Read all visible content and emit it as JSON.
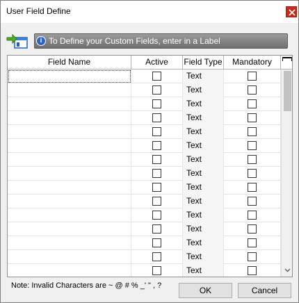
{
  "window": {
    "title": "User Field Define"
  },
  "toolbar": {
    "icon": "define-fields-icon"
  },
  "banner": {
    "text": "To Define your Custom Fields, enter in a  Label"
  },
  "grid": {
    "columns": [
      "Field Name",
      "Active",
      "Field Type",
      "Mandatory"
    ],
    "rows": [
      {
        "field_name": "",
        "active": false,
        "field_type": "Text",
        "mandatory": false
      },
      {
        "field_name": "",
        "active": false,
        "field_type": "Text",
        "mandatory": false
      },
      {
        "field_name": "",
        "active": false,
        "field_type": "Text",
        "mandatory": false
      },
      {
        "field_name": "",
        "active": false,
        "field_type": "Text",
        "mandatory": false
      },
      {
        "field_name": "",
        "active": false,
        "field_type": "Text",
        "mandatory": false
      },
      {
        "field_name": "",
        "active": false,
        "field_type": "Text",
        "mandatory": false
      },
      {
        "field_name": "",
        "active": false,
        "field_type": "Text",
        "mandatory": false
      },
      {
        "field_name": "",
        "active": false,
        "field_type": "Text",
        "mandatory": false
      },
      {
        "field_name": "",
        "active": false,
        "field_type": "Text",
        "mandatory": false
      },
      {
        "field_name": "",
        "active": false,
        "field_type": "Text",
        "mandatory": false
      },
      {
        "field_name": "",
        "active": false,
        "field_type": "Text",
        "mandatory": false
      },
      {
        "field_name": "",
        "active": false,
        "field_type": "Text",
        "mandatory": false
      },
      {
        "field_name": "",
        "active": false,
        "field_type": "Text",
        "mandatory": false
      },
      {
        "field_name": "",
        "active": false,
        "field_type": "Text",
        "mandatory": false
      },
      {
        "field_name": "",
        "active": false,
        "field_type": "Text",
        "mandatory": false
      }
    ]
  },
  "footer": {
    "note": "Note: Invalid Characters are ~ @ # % _' \" , ?",
    "ok_label": "OK",
    "cancel_label": "Cancel"
  },
  "colors": {
    "close_button": "#c42b1c",
    "banner_bg": "#7f7f7f",
    "info_icon": "#2a66c9"
  }
}
